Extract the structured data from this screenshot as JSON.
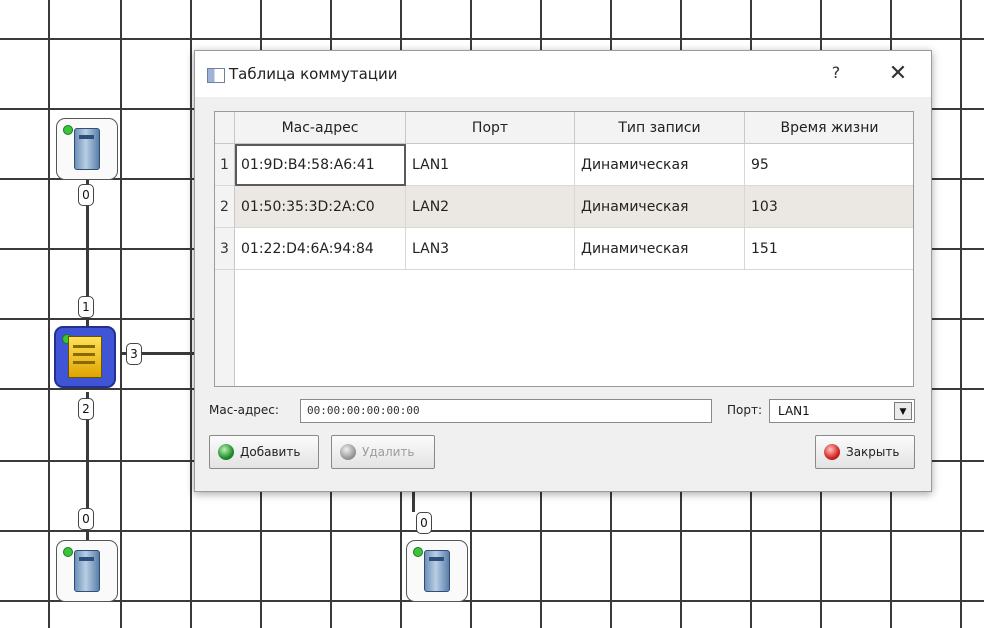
{
  "window": {
    "title": "Таблица коммутации",
    "help_icon": "?",
    "close_icon": "✕"
  },
  "table": {
    "columns": [
      "Mac-адрес",
      "Порт",
      "Тип записи",
      "Время жизни"
    ],
    "rows": [
      {
        "num": "1",
        "mac": "01:9D:B4:58:A6:41",
        "port": "LAN1",
        "type": "Динамическая",
        "ttl": "95"
      },
      {
        "num": "2",
        "mac": "01:50:35:3D:2A:C0",
        "port": "LAN2",
        "type": "Динамическая",
        "ttl": "103"
      },
      {
        "num": "3",
        "mac": "01:22:D4:6A:94:84",
        "port": "LAN3",
        "type": "Динамическая",
        "ttl": "151"
      }
    ]
  },
  "form": {
    "mac_label": "Mac-адрес:",
    "mac_value": "00:00:00:00:00:00",
    "port_label": "Порт:",
    "port_value": "LAN1"
  },
  "buttons": {
    "add": "Добавить",
    "delete": "Удалить",
    "close": "Закрыть"
  },
  "canvas": {
    "port_labels": [
      "0",
      "1",
      "3",
      "2",
      "0",
      "0"
    ],
    "colors": {
      "switch": "#3f55d6",
      "led": "#39c43a",
      "grid": "#3a3a3a"
    }
  }
}
